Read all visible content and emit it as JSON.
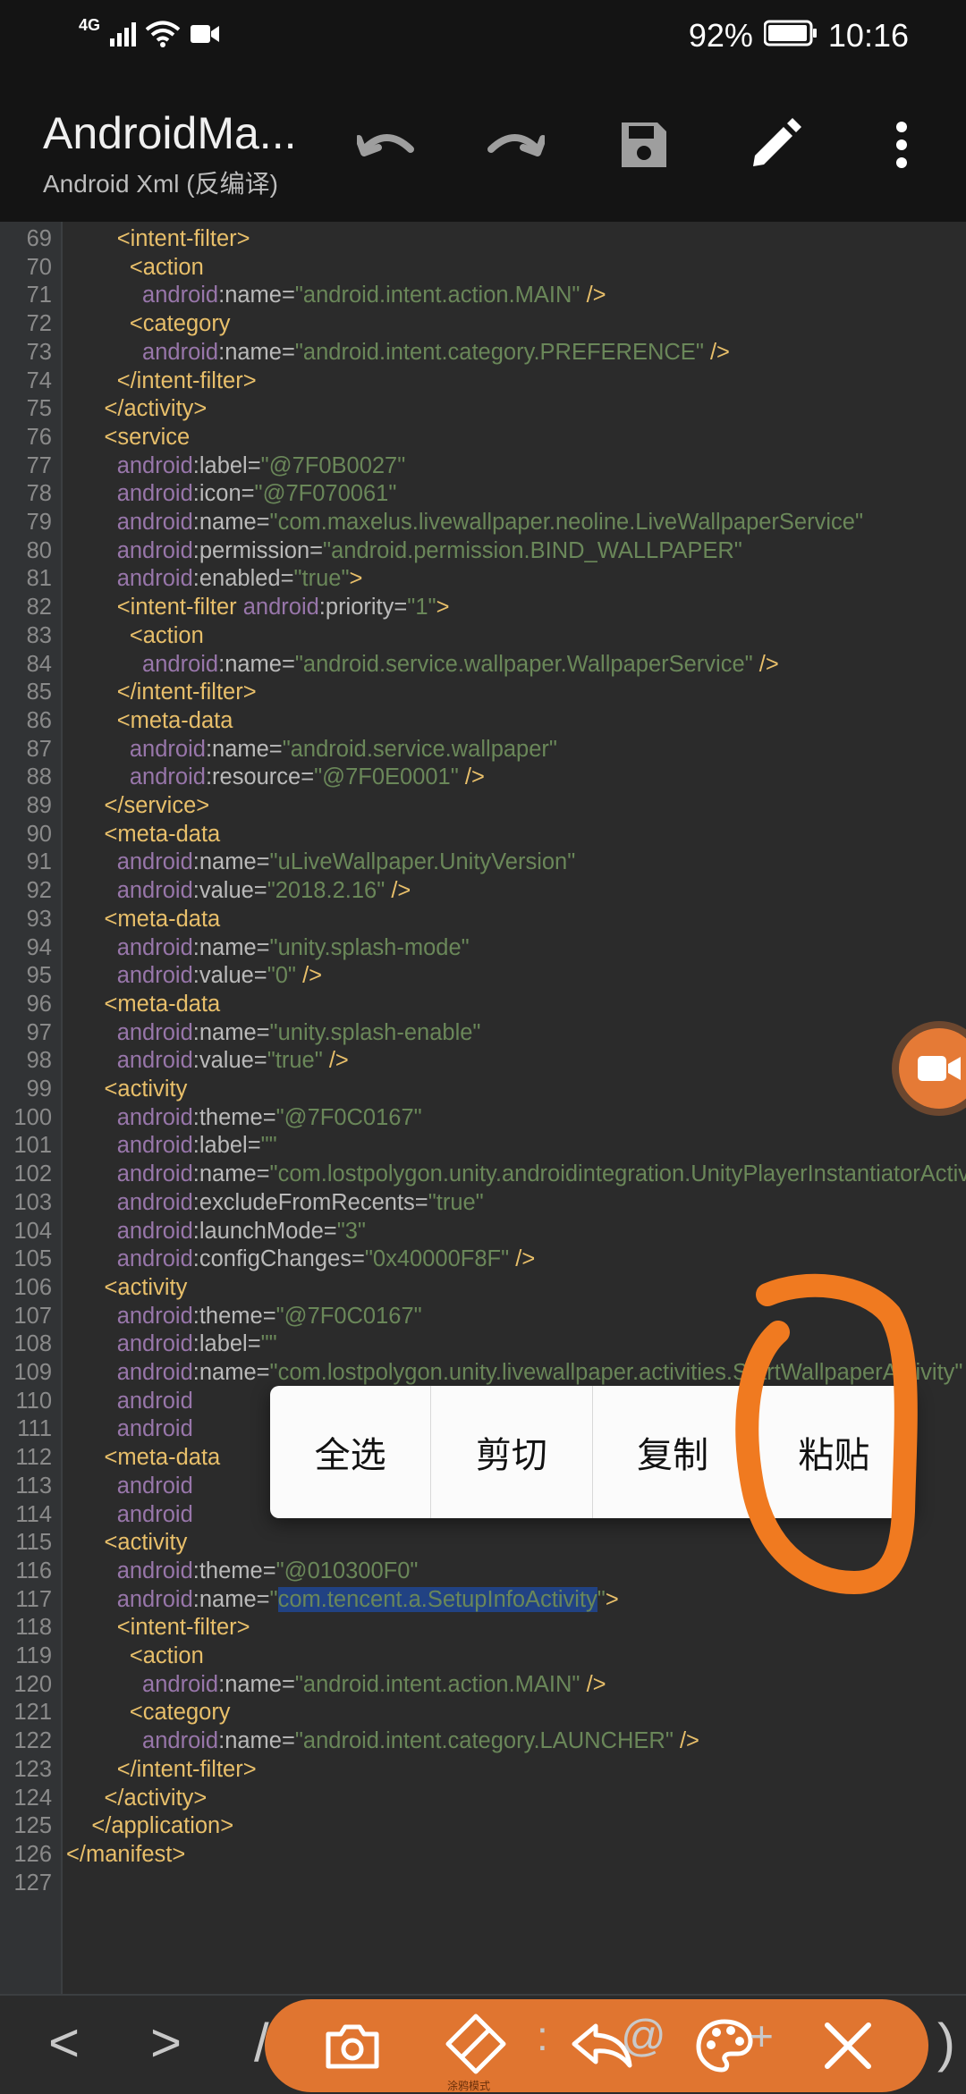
{
  "status_bar": {
    "network": "4G",
    "battery": "92%",
    "time": "10:16"
  },
  "app_bar": {
    "title": "AndroidMa...",
    "subtitle": "Android Xml (反编译)",
    "icons": [
      "undo-icon",
      "redo-icon",
      "save-icon",
      "edit-icon",
      "more-icon"
    ]
  },
  "editor": {
    "lines": [
      {
        "n": "69",
        "seg": [
          [
            "i",
            "        "
          ],
          [
            "t",
            "<intent-filter>"
          ]
        ]
      },
      {
        "n": "70",
        "seg": [
          [
            "i",
            "          "
          ],
          [
            "t",
            "<action"
          ]
        ]
      },
      {
        "n": "71",
        "seg": [
          [
            "i",
            "            "
          ],
          [
            "a",
            "android"
          ],
          [
            "n",
            ":name="
          ],
          [
            "v",
            "\"android.intent.action.MAIN\""
          ],
          [
            "t",
            " />"
          ]
        ]
      },
      {
        "n": "72",
        "seg": [
          [
            "i",
            "          "
          ],
          [
            "t",
            "<category"
          ]
        ]
      },
      {
        "n": "73",
        "seg": [
          [
            "i",
            "            "
          ],
          [
            "a",
            "android"
          ],
          [
            "n",
            ":name="
          ],
          [
            "v",
            "\"android.intent.category.PREFERENCE\""
          ],
          [
            "t",
            " />"
          ]
        ]
      },
      {
        "n": "74",
        "seg": [
          [
            "i",
            "        "
          ],
          [
            "t",
            "</intent-filter>"
          ]
        ]
      },
      {
        "n": "75",
        "seg": [
          [
            "i",
            "      "
          ],
          [
            "t",
            "</activity>"
          ]
        ]
      },
      {
        "n": "76",
        "seg": [
          [
            "i",
            "      "
          ],
          [
            "t",
            "<service"
          ]
        ]
      },
      {
        "n": "77",
        "seg": [
          [
            "i",
            "        "
          ],
          [
            "a",
            "android"
          ],
          [
            "n",
            ":label="
          ],
          [
            "v",
            "\"@7F0B0027\""
          ]
        ]
      },
      {
        "n": "78",
        "seg": [
          [
            "i",
            "        "
          ],
          [
            "a",
            "android"
          ],
          [
            "n",
            ":icon="
          ],
          [
            "v",
            "\"@7F070061\""
          ]
        ]
      },
      {
        "n": "79",
        "seg": [
          [
            "i",
            "        "
          ],
          [
            "a",
            "android"
          ],
          [
            "n",
            ":name="
          ],
          [
            "v",
            "\"com.maxelus.livewallpaper.neoline.LiveWallpaperService\""
          ]
        ]
      },
      {
        "n": "80",
        "seg": [
          [
            "i",
            "        "
          ],
          [
            "a",
            "android"
          ],
          [
            "n",
            ":permission="
          ],
          [
            "v",
            "\"android.permission.BIND_WALLPAPER\""
          ]
        ]
      },
      {
        "n": "81",
        "seg": [
          [
            "i",
            "        "
          ],
          [
            "a",
            "android"
          ],
          [
            "n",
            ":enabled="
          ],
          [
            "v",
            "\"true\""
          ],
          [
            "t",
            ">"
          ]
        ]
      },
      {
        "n": "82",
        "seg": [
          [
            "i",
            "        "
          ],
          [
            "t",
            "<intent-filter "
          ],
          [
            "a",
            "android"
          ],
          [
            "n",
            ":priority="
          ],
          [
            "v",
            "\"1\""
          ],
          [
            "t",
            ">"
          ]
        ]
      },
      {
        "n": "83",
        "seg": [
          [
            "i",
            "          "
          ],
          [
            "t",
            "<action"
          ]
        ]
      },
      {
        "n": "84",
        "seg": [
          [
            "i",
            "            "
          ],
          [
            "a",
            "android"
          ],
          [
            "n",
            ":name="
          ],
          [
            "v",
            "\"android.service.wallpaper.WallpaperService\""
          ],
          [
            "t",
            " />"
          ]
        ]
      },
      {
        "n": "85",
        "seg": [
          [
            "i",
            "        "
          ],
          [
            "t",
            "</intent-filter>"
          ]
        ]
      },
      {
        "n": "86",
        "seg": [
          [
            "i",
            "        "
          ],
          [
            "t",
            "<meta-data"
          ]
        ]
      },
      {
        "n": "87",
        "seg": [
          [
            "i",
            "          "
          ],
          [
            "a",
            "android"
          ],
          [
            "n",
            ":name="
          ],
          [
            "v",
            "\"android.service.wallpaper\""
          ]
        ]
      },
      {
        "n": "88",
        "seg": [
          [
            "i",
            "          "
          ],
          [
            "a",
            "android"
          ],
          [
            "n",
            ":resource="
          ],
          [
            "v",
            "\"@7F0E0001\""
          ],
          [
            "t",
            " />"
          ]
        ]
      },
      {
        "n": "89",
        "seg": [
          [
            "i",
            "      "
          ],
          [
            "t",
            "</service>"
          ]
        ]
      },
      {
        "n": "90",
        "seg": [
          [
            "i",
            "      "
          ],
          [
            "t",
            "<meta-data"
          ]
        ]
      },
      {
        "n": "91",
        "seg": [
          [
            "i",
            "        "
          ],
          [
            "a",
            "android"
          ],
          [
            "n",
            ":name="
          ],
          [
            "v",
            "\"uLiveWallpaper.UnityVersion\""
          ]
        ]
      },
      {
        "n": "92",
        "seg": [
          [
            "i",
            "        "
          ],
          [
            "a",
            "android"
          ],
          [
            "n",
            ":value="
          ],
          [
            "v",
            "\"2018.2.16\""
          ],
          [
            "t",
            " />"
          ]
        ]
      },
      {
        "n": "93",
        "seg": [
          [
            "i",
            "      "
          ],
          [
            "t",
            "<meta-data"
          ]
        ]
      },
      {
        "n": "94",
        "seg": [
          [
            "i",
            "        "
          ],
          [
            "a",
            "android"
          ],
          [
            "n",
            ":name="
          ],
          [
            "v",
            "\"unity.splash-mode\""
          ]
        ]
      },
      {
        "n": "95",
        "seg": [
          [
            "i",
            "        "
          ],
          [
            "a",
            "android"
          ],
          [
            "n",
            ":value="
          ],
          [
            "v",
            "\"0\""
          ],
          [
            "t",
            " />"
          ]
        ]
      },
      {
        "n": "96",
        "seg": [
          [
            "i",
            "      "
          ],
          [
            "t",
            "<meta-data"
          ]
        ]
      },
      {
        "n": "97",
        "seg": [
          [
            "i",
            "        "
          ],
          [
            "a",
            "android"
          ],
          [
            "n",
            ":name="
          ],
          [
            "v",
            "\"unity.splash-enable\""
          ]
        ]
      },
      {
        "n": "98",
        "seg": [
          [
            "i",
            "        "
          ],
          [
            "a",
            "android"
          ],
          [
            "n",
            ":value="
          ],
          [
            "v",
            "\"true\""
          ],
          [
            "t",
            " />"
          ]
        ]
      },
      {
        "n": "99",
        "seg": [
          [
            "i",
            "      "
          ],
          [
            "t",
            "<activity"
          ]
        ]
      },
      {
        "n": "100",
        "seg": [
          [
            "i",
            "        "
          ],
          [
            "a",
            "android"
          ],
          [
            "n",
            ":theme="
          ],
          [
            "v",
            "\"@7F0C0167\""
          ]
        ]
      },
      {
        "n": "101",
        "seg": [
          [
            "i",
            "        "
          ],
          [
            "a",
            "android"
          ],
          [
            "n",
            ":label="
          ],
          [
            "v",
            "\"\""
          ]
        ]
      },
      {
        "n": "102",
        "seg": [
          [
            "i",
            "        "
          ],
          [
            "a",
            "android"
          ],
          [
            "n",
            ":name="
          ],
          [
            "v",
            "\"com.lostpolygon.unity.androidintegration.UnityPlayerInstantiatorActivity\""
          ]
        ]
      },
      {
        "n": "103",
        "seg": [
          [
            "i",
            "        "
          ],
          [
            "a",
            "android"
          ],
          [
            "n",
            ":excludeFromRecents="
          ],
          [
            "v",
            "\"true\""
          ]
        ]
      },
      {
        "n": "104",
        "seg": [
          [
            "i",
            "        "
          ],
          [
            "a",
            "android"
          ],
          [
            "n",
            ":launchMode="
          ],
          [
            "v",
            "\"3\""
          ]
        ]
      },
      {
        "n": "105",
        "seg": [
          [
            "i",
            "        "
          ],
          [
            "a",
            "android"
          ],
          [
            "n",
            ":configChanges="
          ],
          [
            "v",
            "\"0x40000F8F\""
          ],
          [
            "t",
            " />"
          ]
        ]
      },
      {
        "n": "106",
        "seg": [
          [
            "i",
            "      "
          ],
          [
            "t",
            "<activity"
          ]
        ]
      },
      {
        "n": "107",
        "seg": [
          [
            "i",
            "        "
          ],
          [
            "a",
            "android"
          ],
          [
            "n",
            ":theme="
          ],
          [
            "v",
            "\"@7F0C0167\""
          ]
        ]
      },
      {
        "n": "108",
        "seg": [
          [
            "i",
            "        "
          ],
          [
            "a",
            "android"
          ],
          [
            "n",
            ":label="
          ],
          [
            "v",
            "\"\""
          ]
        ]
      },
      {
        "n": "109",
        "seg": [
          [
            "i",
            "        "
          ],
          [
            "a",
            "android"
          ],
          [
            "n",
            ":name="
          ],
          [
            "v",
            "\"com.lostpolygon.unity.livewallpaper.activities.StartWallpaperActivity\""
          ]
        ]
      },
      {
        "n": "110",
        "seg": [
          [
            "i",
            "        "
          ],
          [
            "a",
            "android"
          ]
        ]
      },
      {
        "n": "111",
        "seg": [
          [
            "i",
            "        "
          ],
          [
            "a",
            "android"
          ]
        ]
      },
      {
        "n": "112",
        "seg": [
          [
            "i",
            "      "
          ],
          [
            "t",
            "<meta-data"
          ]
        ]
      },
      {
        "n": "113",
        "seg": [
          [
            "i",
            "        "
          ],
          [
            "a",
            "android"
          ]
        ]
      },
      {
        "n": "114",
        "seg": [
          [
            "i",
            "        "
          ],
          [
            "a",
            "android"
          ]
        ]
      },
      {
        "n": "115",
        "seg": [
          [
            "i",
            "      "
          ],
          [
            "t",
            "<activity"
          ]
        ]
      },
      {
        "n": "116",
        "seg": [
          [
            "i",
            "        "
          ],
          [
            "a",
            "android"
          ],
          [
            "n",
            ":theme="
          ],
          [
            "v",
            "\"@010300F0\""
          ]
        ]
      },
      {
        "n": "117",
        "seg": [
          [
            "i",
            "        "
          ],
          [
            "a",
            "android"
          ],
          [
            "n",
            ":name="
          ],
          [
            "v",
            "\""
          ],
          [
            "s",
            "com.tencent.a.SetupInfoActivity"
          ],
          [
            "v",
            "\""
          ],
          [
            "t",
            ">"
          ]
        ]
      },
      {
        "n": "118",
        "seg": [
          [
            "i",
            "        "
          ],
          [
            "t",
            "<intent-filter>"
          ]
        ]
      },
      {
        "n": "119",
        "seg": [
          [
            "i",
            "          "
          ],
          [
            "t",
            "<action"
          ]
        ]
      },
      {
        "n": "120",
        "seg": [
          [
            "i",
            "            "
          ],
          [
            "a",
            "android"
          ],
          [
            "n",
            ":name="
          ],
          [
            "v",
            "\"android.intent.action.MAIN\""
          ],
          [
            "t",
            " />"
          ]
        ]
      },
      {
        "n": "121",
        "seg": [
          [
            "i",
            "          "
          ],
          [
            "t",
            "<category"
          ]
        ]
      },
      {
        "n": "122",
        "seg": [
          [
            "i",
            "            "
          ],
          [
            "a",
            "android"
          ],
          [
            "n",
            ":name="
          ],
          [
            "v",
            "\"android.intent.category.LAUNCHER\""
          ],
          [
            "t",
            " />"
          ]
        ]
      },
      {
        "n": "123",
        "seg": [
          [
            "i",
            "        "
          ],
          [
            "t",
            "</intent-filter>"
          ]
        ]
      },
      {
        "n": "124",
        "seg": [
          [
            "i",
            "      "
          ],
          [
            "t",
            "</activity>"
          ]
        ]
      },
      {
        "n": "125",
        "seg": [
          [
            "i",
            "    "
          ],
          [
            "t",
            "</application>"
          ]
        ]
      },
      {
        "n": "126",
        "seg": [
          [
            "t",
            "</manifest>"
          ]
        ]
      },
      {
        "n": "127",
        "seg": []
      }
    ]
  },
  "context_menu": {
    "select_all": "全选",
    "cut": "剪切",
    "copy": "复制",
    "paste": "粘贴"
  },
  "bottom_bar": {
    "back": "<",
    "forward": ">",
    "slash": "/",
    "colon": ":",
    "at": "@",
    "plus": "+",
    "paren": ")"
  },
  "overlay_toolbar": {
    "label": "涂鸦模式",
    "icons": [
      "camera-icon",
      "eraser-icon",
      "undo-arrow-icon",
      "palette-icon",
      "close-icon"
    ]
  },
  "colors": {
    "background": "#2b2b2b",
    "tag": "#e8bf6a",
    "attribute": "#9876aa",
    "value": "#6a8759",
    "selection": "#214283",
    "annotation": "#f07a20"
  }
}
